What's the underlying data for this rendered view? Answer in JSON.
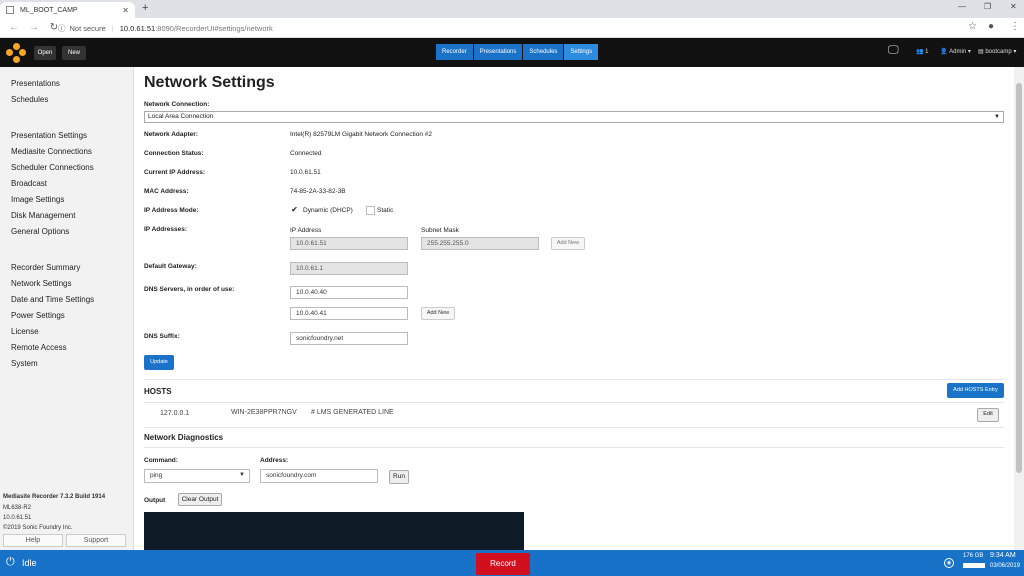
{
  "browser": {
    "tab_title": "ML_BOOT_CAMP",
    "not_secure": "Not secure",
    "url_host": "10.0.61.51",
    "url_path": ":8090/RecorderUI#settings/network"
  },
  "header": {
    "open_label": "Open",
    "new_label": "New",
    "tabs": [
      "Recorder",
      "Presentations",
      "Schedules",
      "Settings"
    ],
    "active_tab": "Settings",
    "user_count": "1",
    "user_label": "Admin",
    "bootcamp_label": "bootcamp"
  },
  "sidebar": {
    "group1": [
      "Presentations",
      "Schedules"
    ],
    "group2": [
      "Presentation Settings",
      "Mediasite Connections",
      "Scheduler Connections",
      "Broadcast",
      "Image Settings",
      "Disk Management",
      "General Options"
    ],
    "group3": [
      "Recorder Summary",
      "Network Settings",
      "Date and Time Settings",
      "Power Settings",
      "License",
      "Remote Access",
      "System"
    ],
    "footer": {
      "product": "Mediasite Recorder 7.3.2 Build 1914",
      "model": "ML638-R2",
      "ip": "10.0.61.51",
      "copyright": "©2019 Sonic Foundry Inc."
    },
    "help_label": "Help",
    "support_label": "Support"
  },
  "page": {
    "title": "Network Settings",
    "network_connection_label": "Network Connection:",
    "network_connection_value": "Local Area Connection",
    "adapter_label": "Network Adapter:",
    "adapter_value": "Intel(R) 82579LM Gigabit Network Connection #2",
    "status_label": "Connection Status:",
    "status_value": "Connected",
    "current_ip_label": "Current IP Address:",
    "current_ip_value": "10.0.61.51",
    "mac_label": "MAC Address:",
    "mac_value": "74-85-2A-33-82-3B",
    "ip_mode_label": "IP Address Mode:",
    "dhcp_label": "Dynamic (DHCP)",
    "static_label": "Static",
    "ip_addresses_label": "IP Addresses:",
    "ip_col_label": "IP Address",
    "mask_col_label": "Subnet Mask",
    "ip_value": "10.0.61.51",
    "mask_value": "255.255.255.0",
    "add_new_label": "Add New",
    "gateway_label": "Default Gateway:",
    "gateway_value": "10.0.61.1",
    "dns_label": "DNS Servers, in order of use:",
    "dns1": "10.0.40.40",
    "dns2": "10.0.40.41",
    "dns_add_new": "Add New",
    "suffix_label": "DNS Suffix:",
    "suffix_value": "sonicfoundry.net",
    "update_label": "Update"
  },
  "hosts": {
    "title": "HOSTS",
    "add_label": "Add HOSTS Entry",
    "entry_ip": "127.0.0.1",
    "entry_name": "WIN-2E38PPR7NGV",
    "entry_comment": "# LMS GENERATED LINE",
    "edit_label": "Edit"
  },
  "diagnostics": {
    "title": "Network Diagnostics",
    "command_label": "Command:",
    "command_value": "ping",
    "address_label": "Address:",
    "address_value": "sonicfoundry.com",
    "run_label": "Run",
    "output_label": "Output",
    "clear_label": "Clear Output"
  },
  "status": {
    "state": "Idle",
    "record_label": "Record",
    "disk": "176 GB",
    "time": "9:34 AM",
    "date": "03/06/2019"
  }
}
